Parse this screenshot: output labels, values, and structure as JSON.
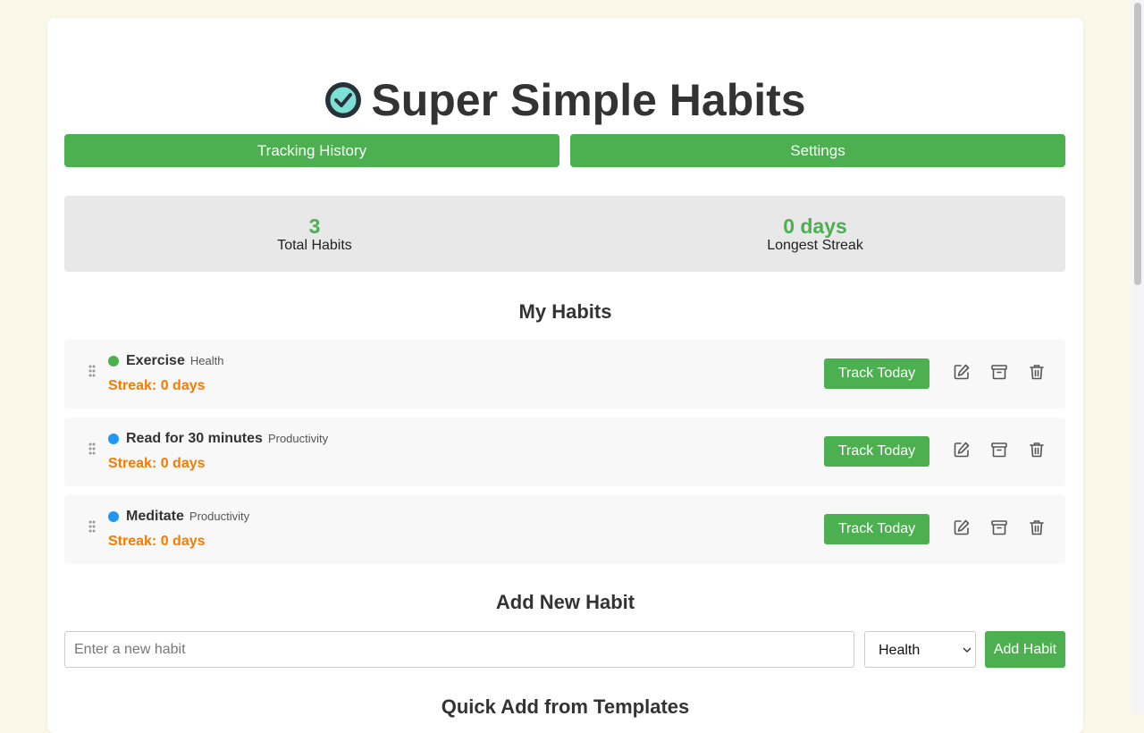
{
  "app": {
    "title": "Super Simple Habits",
    "logo_icon": "check-badge-icon",
    "accent": "#4caf50",
    "streak_color": "#f57c00"
  },
  "nav": {
    "history_label": "Tracking History",
    "settings_label": "Settings"
  },
  "stats": {
    "total_value": "3",
    "total_label": "Total Habits",
    "streak_value": "0 days",
    "streak_label": "Longest Streak"
  },
  "habits_section": {
    "title": "My Habits",
    "items": [
      {
        "name": "Exercise",
        "category": "Health",
        "streak": "Streak: 0 days",
        "color": "#4caf50",
        "track_label": "Track Today"
      },
      {
        "name": "Read for 30 minutes",
        "category": "Productivity",
        "streak": "Streak: 0 days",
        "color": "#2196f3",
        "track_label": "Track Today"
      },
      {
        "name": "Meditate",
        "category": "Productivity",
        "streak": "Streak: 0 days",
        "color": "#2196f3",
        "track_label": "Track Today"
      }
    ]
  },
  "add_section": {
    "title": "Add New Habit",
    "placeholder": "Enter a new habit",
    "category_selected": "Health",
    "add_label": "Add Habit"
  },
  "templates_section": {
    "title": "Quick Add from Templates"
  }
}
